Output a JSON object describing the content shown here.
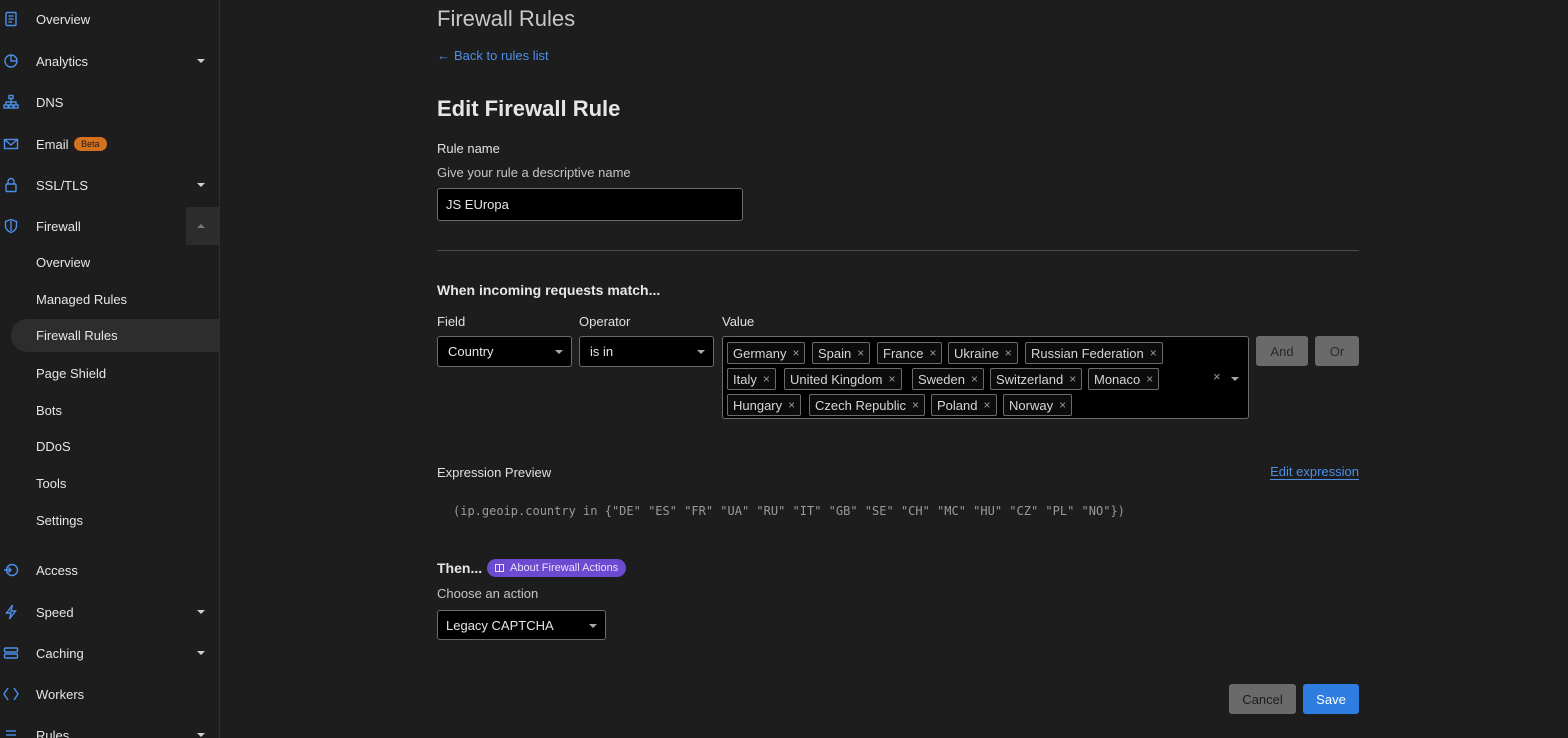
{
  "sidebar": {
    "items": [
      {
        "label": "Overview",
        "icon": "document-icon"
      },
      {
        "label": "Analytics",
        "icon": "analytics-icon"
      },
      {
        "label": "DNS",
        "icon": "dns-icon"
      },
      {
        "label": "Email",
        "icon": "email-icon",
        "badge": "Beta"
      },
      {
        "label": "SSL/TLS",
        "icon": "lock-icon"
      },
      {
        "label": "Firewall",
        "icon": "shield-icon"
      },
      {
        "label": "Access",
        "icon": "access-icon"
      },
      {
        "label": "Speed",
        "icon": "lightning-icon"
      },
      {
        "label": "Caching",
        "icon": "caching-icon"
      },
      {
        "label": "Workers",
        "icon": "workers-icon"
      },
      {
        "label": "Rules",
        "icon": "rules-icon"
      }
    ],
    "firewall_sub": [
      "Overview",
      "Managed Rules",
      "Firewall Rules",
      "Page Shield",
      "Bots",
      "DDoS",
      "Tools",
      "Settings"
    ]
  },
  "main": {
    "page_title": "Firewall Rules",
    "back_link": "Back to rules list",
    "edit_title": "Edit Firewall Rule",
    "rule_name_label": "Rule name",
    "rule_name_help": "Give your rule a descriptive name",
    "rule_name_value": "JS EUropa",
    "match_heading": "When incoming requests match...",
    "field_label": "Field",
    "operator_label": "Operator",
    "value_label": "Value",
    "field_value": "Country",
    "operator_value": "is in",
    "tags": [
      "Germany",
      "Spain",
      "France",
      "Ukraine",
      "Russian Federation",
      "Italy",
      "United Kingdom",
      "Sweden",
      "Switzerland",
      "Monaco",
      "Hungary",
      "Czech Republic",
      "Poland",
      "Norway"
    ],
    "and_label": "And",
    "or_label": "Or",
    "expression_label": "Expression Preview",
    "edit_expression": "Edit expression",
    "expression": "(ip.geoip.country in {\"DE\" \"ES\" \"FR\" \"UA\" \"RU\" \"IT\" \"GB\" \"SE\" \"CH\" \"MC\" \"HU\" \"CZ\" \"PL\" \"NO\"})",
    "then_heading": "Then...",
    "about_actions": "About Firewall Actions",
    "choose_action_label": "Choose an action",
    "action_value": "Legacy CAPTCHA",
    "cancel_label": "Cancel",
    "save_label": "Save"
  },
  "colors": {
    "background": "#1d1d1d",
    "accent": "#4d8fe8",
    "save": "#2f7de0",
    "badge_beta": "#f38020",
    "badge_about": "#6c4bd0"
  }
}
